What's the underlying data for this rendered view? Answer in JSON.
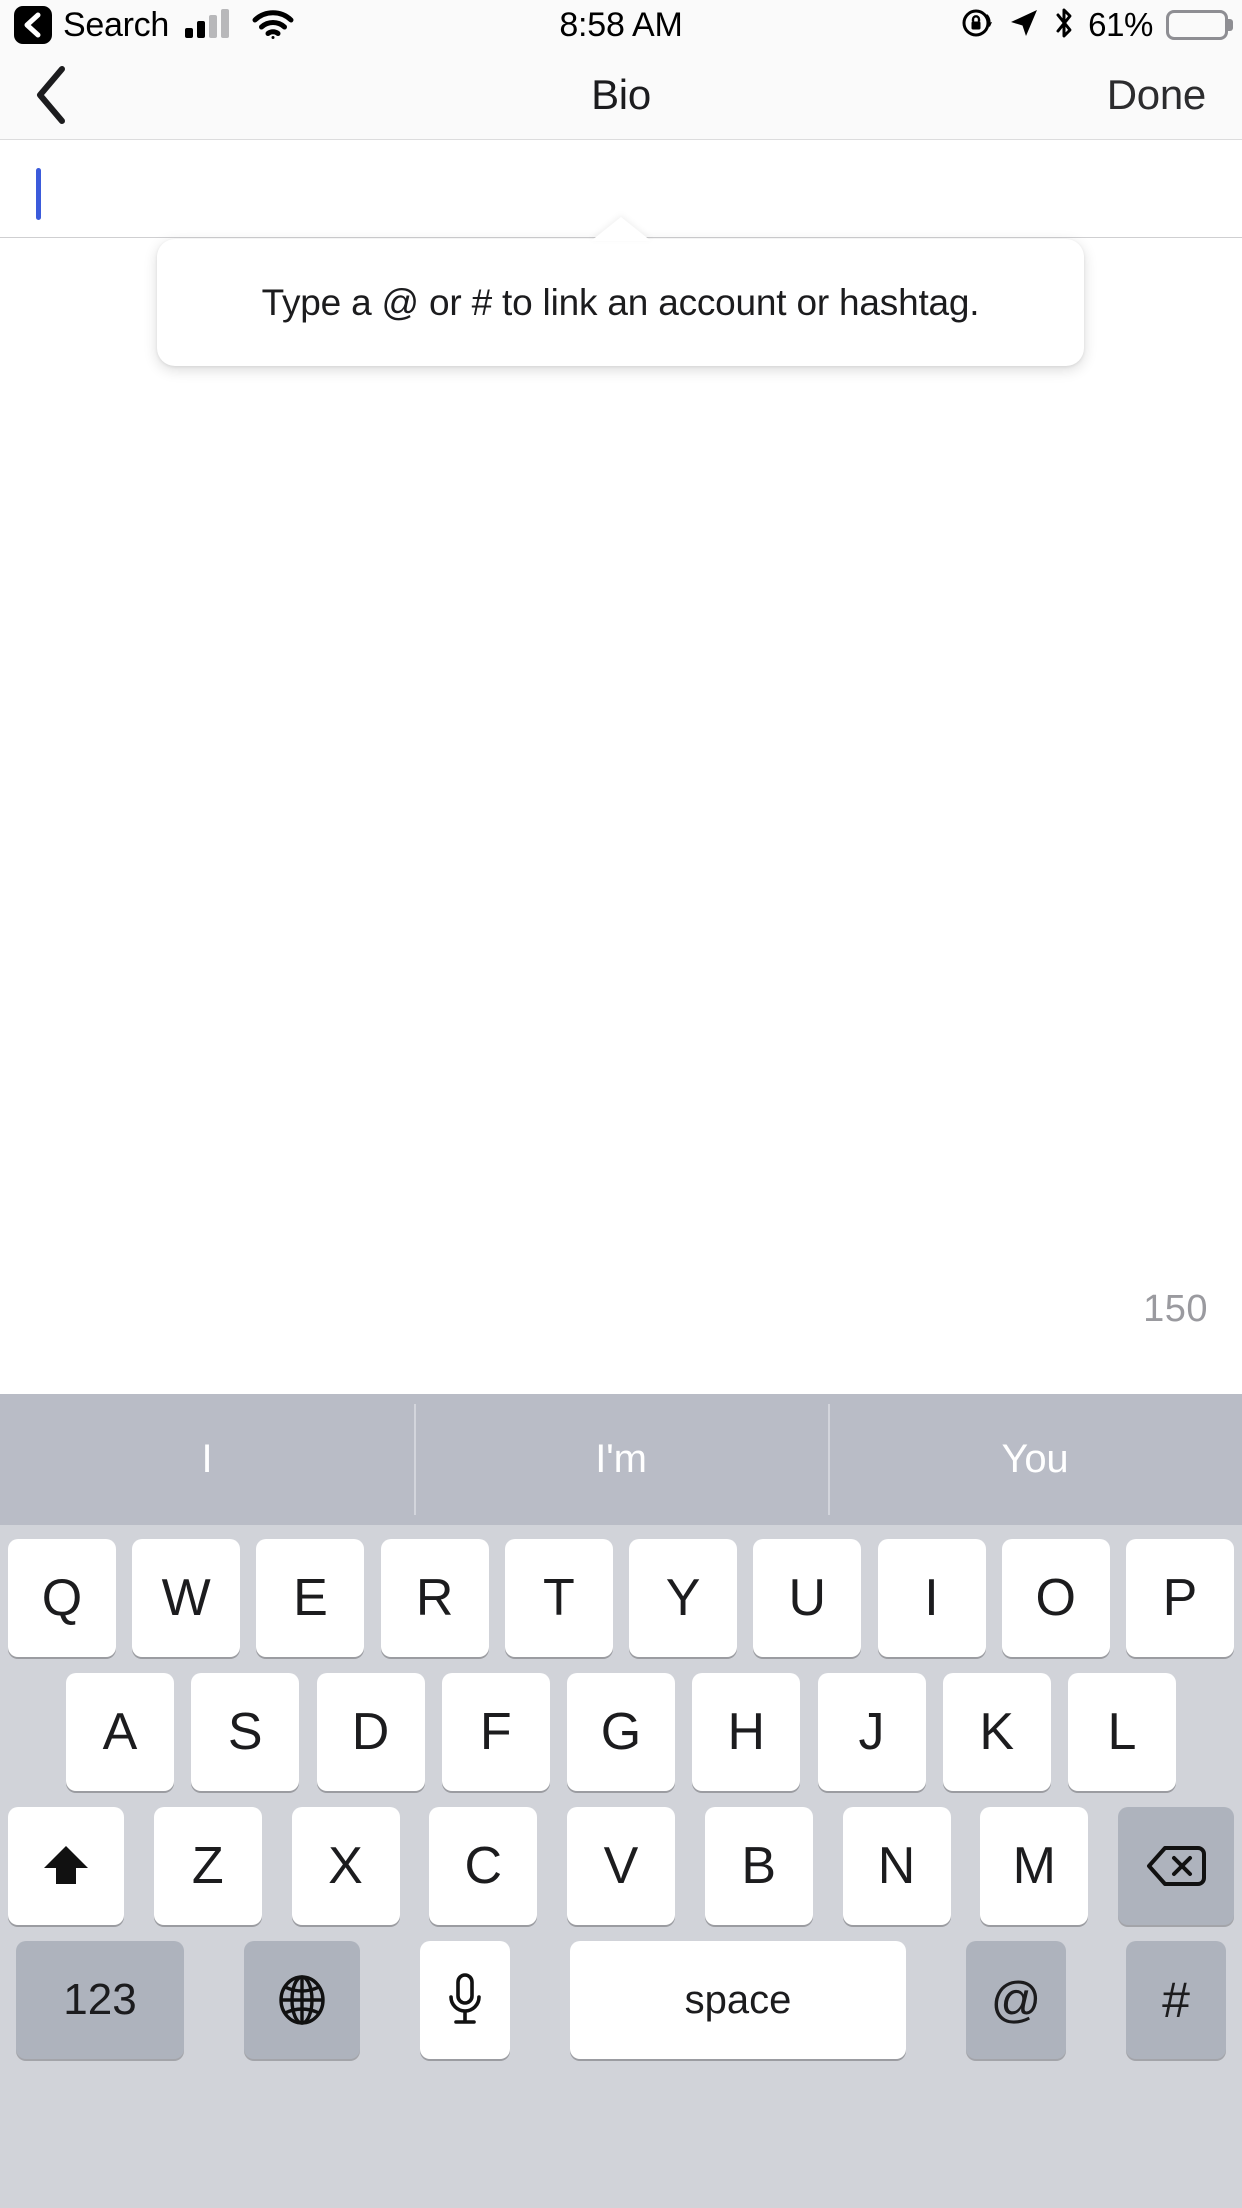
{
  "status_bar": {
    "back_label": "Search",
    "back_icon": "chevron-left-boxed-icon",
    "signal_icon": "cellular-signal-icon",
    "wifi_icon": "wifi-icon",
    "time": "8:58 AM",
    "rotation_lock_icon": "rotation-lock-icon",
    "location_icon": "location-arrow-icon",
    "bluetooth_icon": "bluetooth-icon",
    "battery_percent": "61%",
    "battery_level": 61
  },
  "nav_bar": {
    "back_icon": "chevron-left-icon",
    "title": "Bio",
    "done_label": "Done"
  },
  "bio_field": {
    "value": "",
    "placeholder": "",
    "caret_color": "#3b5bdb"
  },
  "tooltip": {
    "text": "Type a @ or # to link an account or hashtag.",
    "arrow": "up"
  },
  "char_counter": {
    "remaining": "150"
  },
  "keyboard": {
    "predictions": [
      "I",
      "I'm",
      "You"
    ],
    "row1": [
      "Q",
      "W",
      "E",
      "R",
      "T",
      "Y",
      "U",
      "I",
      "O",
      "P"
    ],
    "row2": [
      "A",
      "S",
      "D",
      "F",
      "G",
      "H",
      "J",
      "K",
      "L"
    ],
    "row3_letters": [
      "Z",
      "X",
      "C",
      "V",
      "B",
      "N",
      "M"
    ],
    "shift_icon": "shift-arrow-up-icon",
    "delete_icon": "backspace-delete-icon",
    "numeric_label": "123",
    "globe_icon": "globe-language-icon",
    "mic_icon": "microphone-icon",
    "space_label": "space",
    "at_label": "@",
    "hash_label": "#"
  },
  "colors": {
    "keyboard_bg": "#d1d3d9",
    "predict_bg": "#b9bcc6",
    "fn_key_bg": "#aeb3bd",
    "key_bg": "#ffffff",
    "nav_bg": "#fafafa",
    "counter_gray": "#9a9a9f"
  }
}
